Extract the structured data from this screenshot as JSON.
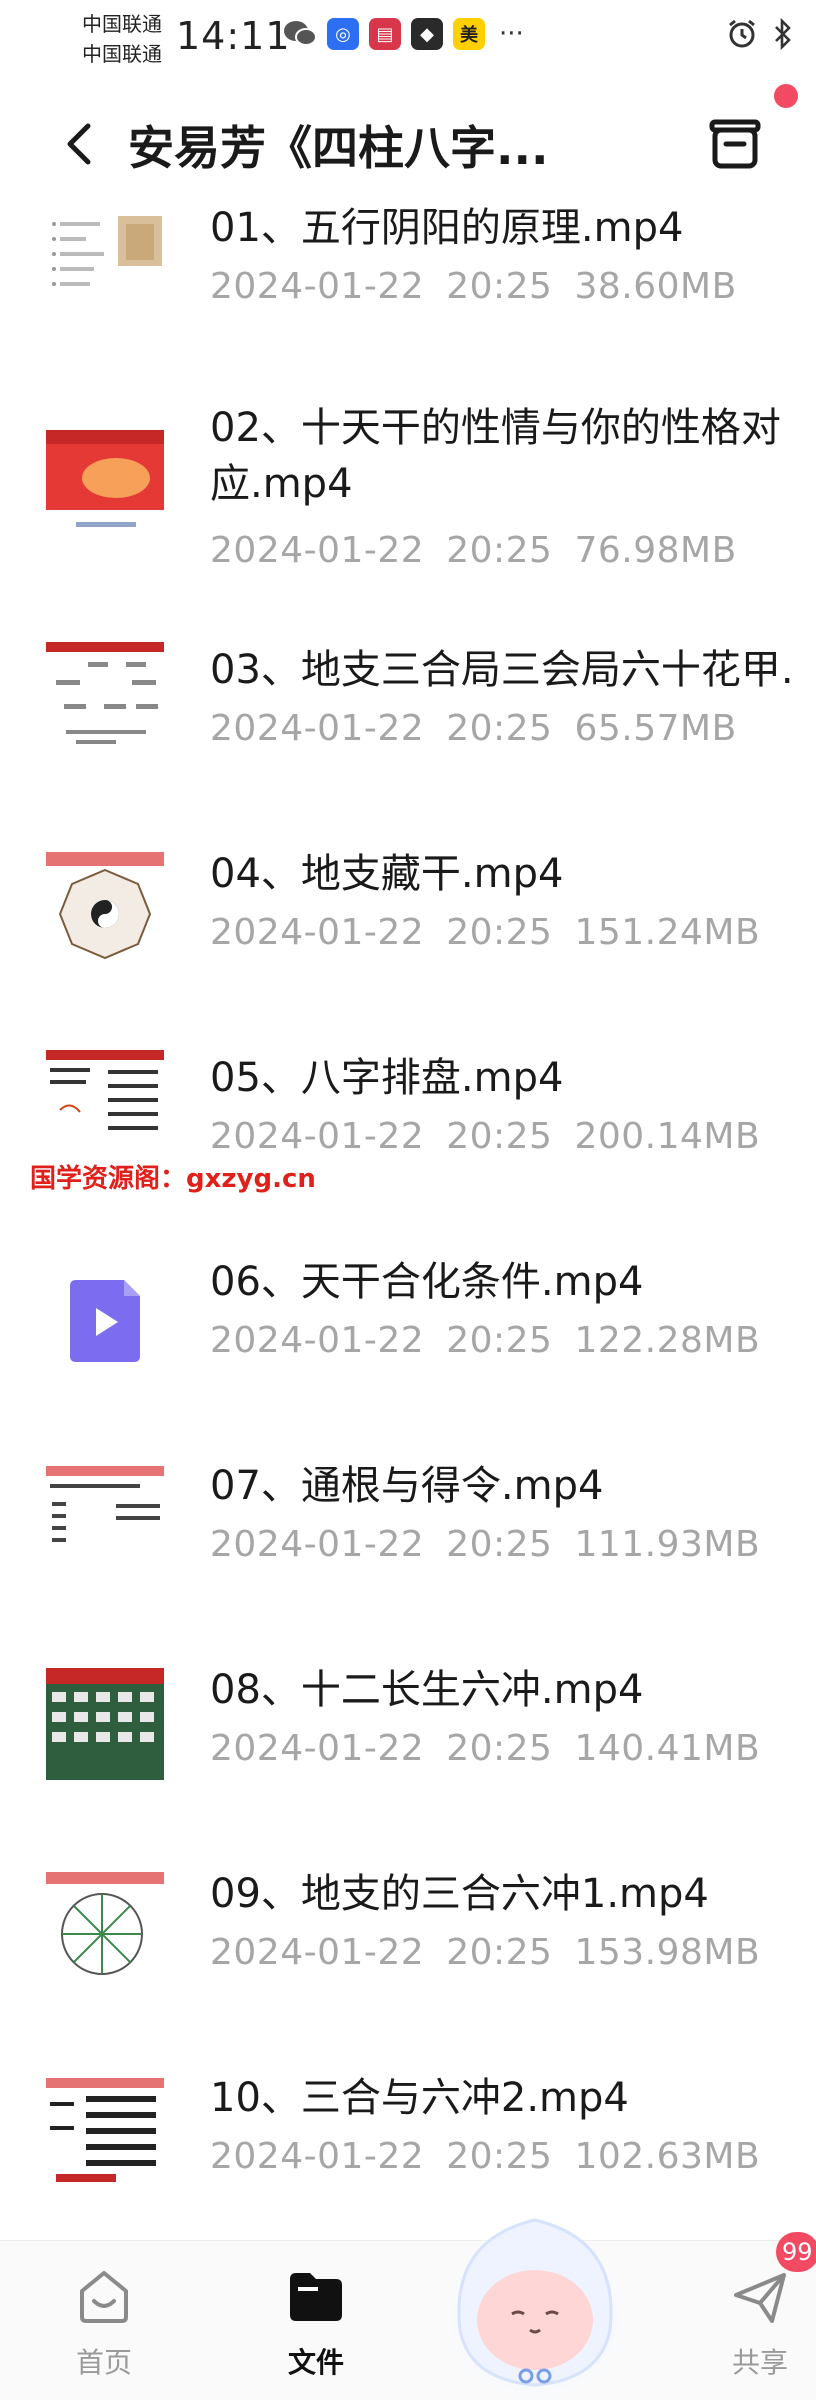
{
  "status_bar": {
    "carrier_1": "中国联通",
    "carrier_2": "中国联通",
    "time": "14:11",
    "more": "···",
    "icons": [
      "wechat-icon",
      "app-blue-icon",
      "app-red-icon",
      "app-shield-icon",
      "meituan-icon",
      "alarm-icon",
      "bluetooth-icon"
    ],
    "meituan_label": "美"
  },
  "header": {
    "title": "安易芳《四柱八字...",
    "notification_color": "#f24a63"
  },
  "files": [
    {
      "name": "01、五行阴阳的原理.mp4",
      "date": "2024-01-22",
      "time": "20:25",
      "size": "38.60MB"
    },
    {
      "name": "02、十天干的性情与你的性格对应.mp4",
      "date": "2024-01-22",
      "time": "20:25",
      "size": "76.98MB"
    },
    {
      "name": "03、地支三合局三会局六十花甲.",
      "date": "2024-01-22",
      "time": "20:25",
      "size": "65.57MB"
    },
    {
      "name": "04、地支藏干.mp4",
      "date": "2024-01-22",
      "time": "20:25",
      "size": "151.24MB"
    },
    {
      "name": "05、八字排盘.mp4",
      "date": "2024-01-22",
      "time": "20:25",
      "size": "200.14MB"
    },
    {
      "name": "06、天干合化条件.mp4",
      "date": "2024-01-22",
      "time": "20:25",
      "size": "122.28MB"
    },
    {
      "name": "07、通根与得令.mp4",
      "date": "2024-01-22",
      "time": "20:25",
      "size": "111.93MB"
    },
    {
      "name": "08、十二长生六冲.mp4",
      "date": "2024-01-22",
      "time": "20:25",
      "size": "140.41MB"
    },
    {
      "name": "09、地支的三合六冲1.mp4",
      "date": "2024-01-22",
      "time": "20:25",
      "size": "153.98MB"
    },
    {
      "name": "10、三合与六冲2.mp4",
      "date": "2024-01-22",
      "time": "20:25",
      "size": "102.63MB"
    }
  ],
  "watermark": "国学资源阁：gxzyg.cn",
  "bottom_nav": {
    "home": "首页",
    "files": "文件",
    "share": "共享",
    "share_badge": "99",
    "active": "files"
  },
  "colors": {
    "accent_red": "#f24a63",
    "video_icon_purple": "#7b6cf0",
    "meta_gray": "#a6a6a6"
  }
}
